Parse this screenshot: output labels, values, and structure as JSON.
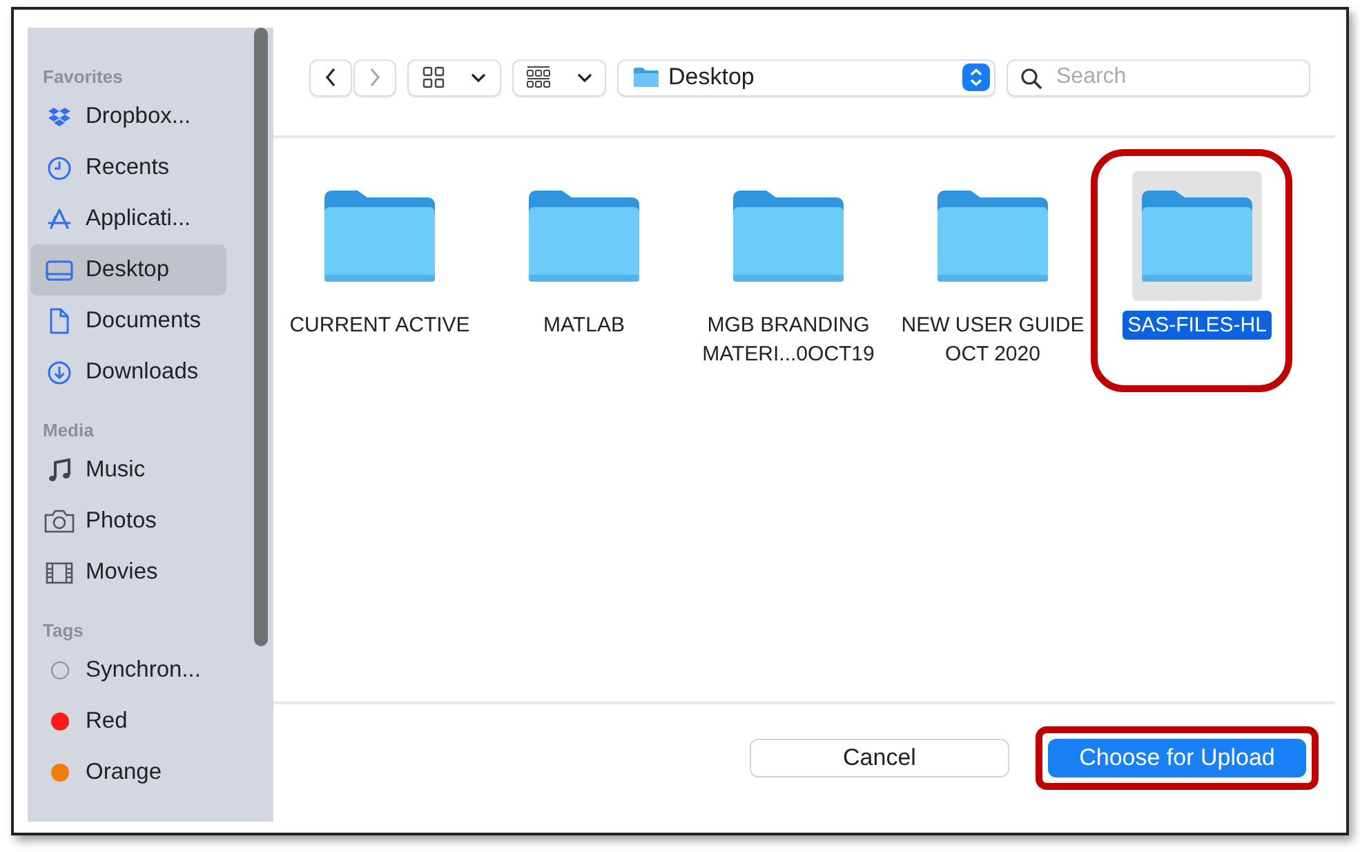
{
  "sidebar": {
    "sections": [
      {
        "title": "Favorites",
        "items": [
          {
            "label": "Dropbox...",
            "selected": false
          },
          {
            "label": "Recents",
            "selected": false
          },
          {
            "label": "Applicati...",
            "selected": false
          },
          {
            "label": "Desktop",
            "selected": true
          },
          {
            "label": "Documents",
            "selected": false
          },
          {
            "label": "Downloads",
            "selected": false
          }
        ]
      },
      {
        "title": "Media",
        "items": [
          {
            "label": "Music",
            "selected": false
          },
          {
            "label": "Photos",
            "selected": false
          },
          {
            "label": "Movies",
            "selected": false
          }
        ]
      },
      {
        "title": "Tags",
        "items": [
          {
            "label": "Synchron...",
            "selected": false,
            "kind": "outline",
            "color": "#8e8e93"
          },
          {
            "label": "Red",
            "selected": false,
            "kind": "dot",
            "color": "#ff1a1a"
          },
          {
            "label": "Orange",
            "selected": false,
            "kind": "dot",
            "color": "#f07c0c"
          }
        ]
      }
    ]
  },
  "toolbar": {
    "location": "Desktop",
    "search": {
      "placeholder": "Search"
    }
  },
  "files": [
    {
      "name": "CURRENT ACTIVE",
      "selected": false,
      "highlighted": false
    },
    {
      "name": "MATLAB",
      "selected": false,
      "highlighted": false
    },
    {
      "name": "MGB BRANDING MATERI...0OCT19",
      "selected": false,
      "highlighted": false
    },
    {
      "name": "NEW USER GUIDE OCT 2020",
      "selected": false,
      "highlighted": false
    },
    {
      "name": "SAS-FILES-HL",
      "selected": true,
      "highlighted": true
    }
  ],
  "buttons": [
    {
      "label": "Cancel",
      "kind": "secondary",
      "highlighted": false
    },
    {
      "label": "Choose for Upload",
      "kind": "primary",
      "highlighted": true
    }
  ]
}
